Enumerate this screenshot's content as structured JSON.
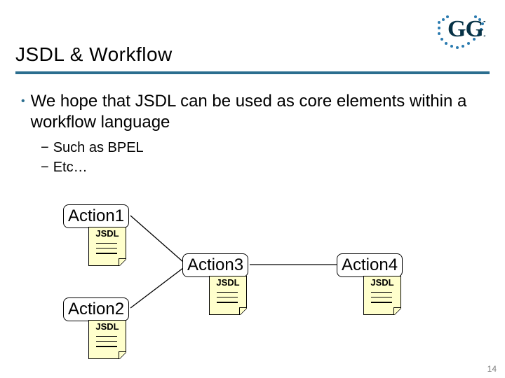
{
  "logo": {
    "text": "GGF"
  },
  "title": "JSDL & Workflow",
  "bullet": {
    "text": "We hope that JSDL can be used as core elements within a workflow language",
    "subs": [
      "Such as BPEL",
      "Etc…"
    ]
  },
  "actions": {
    "a1": {
      "label": "Action1",
      "note": "JSDL"
    },
    "a2": {
      "label": "Action2",
      "note": "JSDL"
    },
    "a3": {
      "label": "Action3",
      "note": "JSDL"
    },
    "a4": {
      "label": "Action4",
      "note": "JSDL"
    }
  },
  "page_number": "14"
}
